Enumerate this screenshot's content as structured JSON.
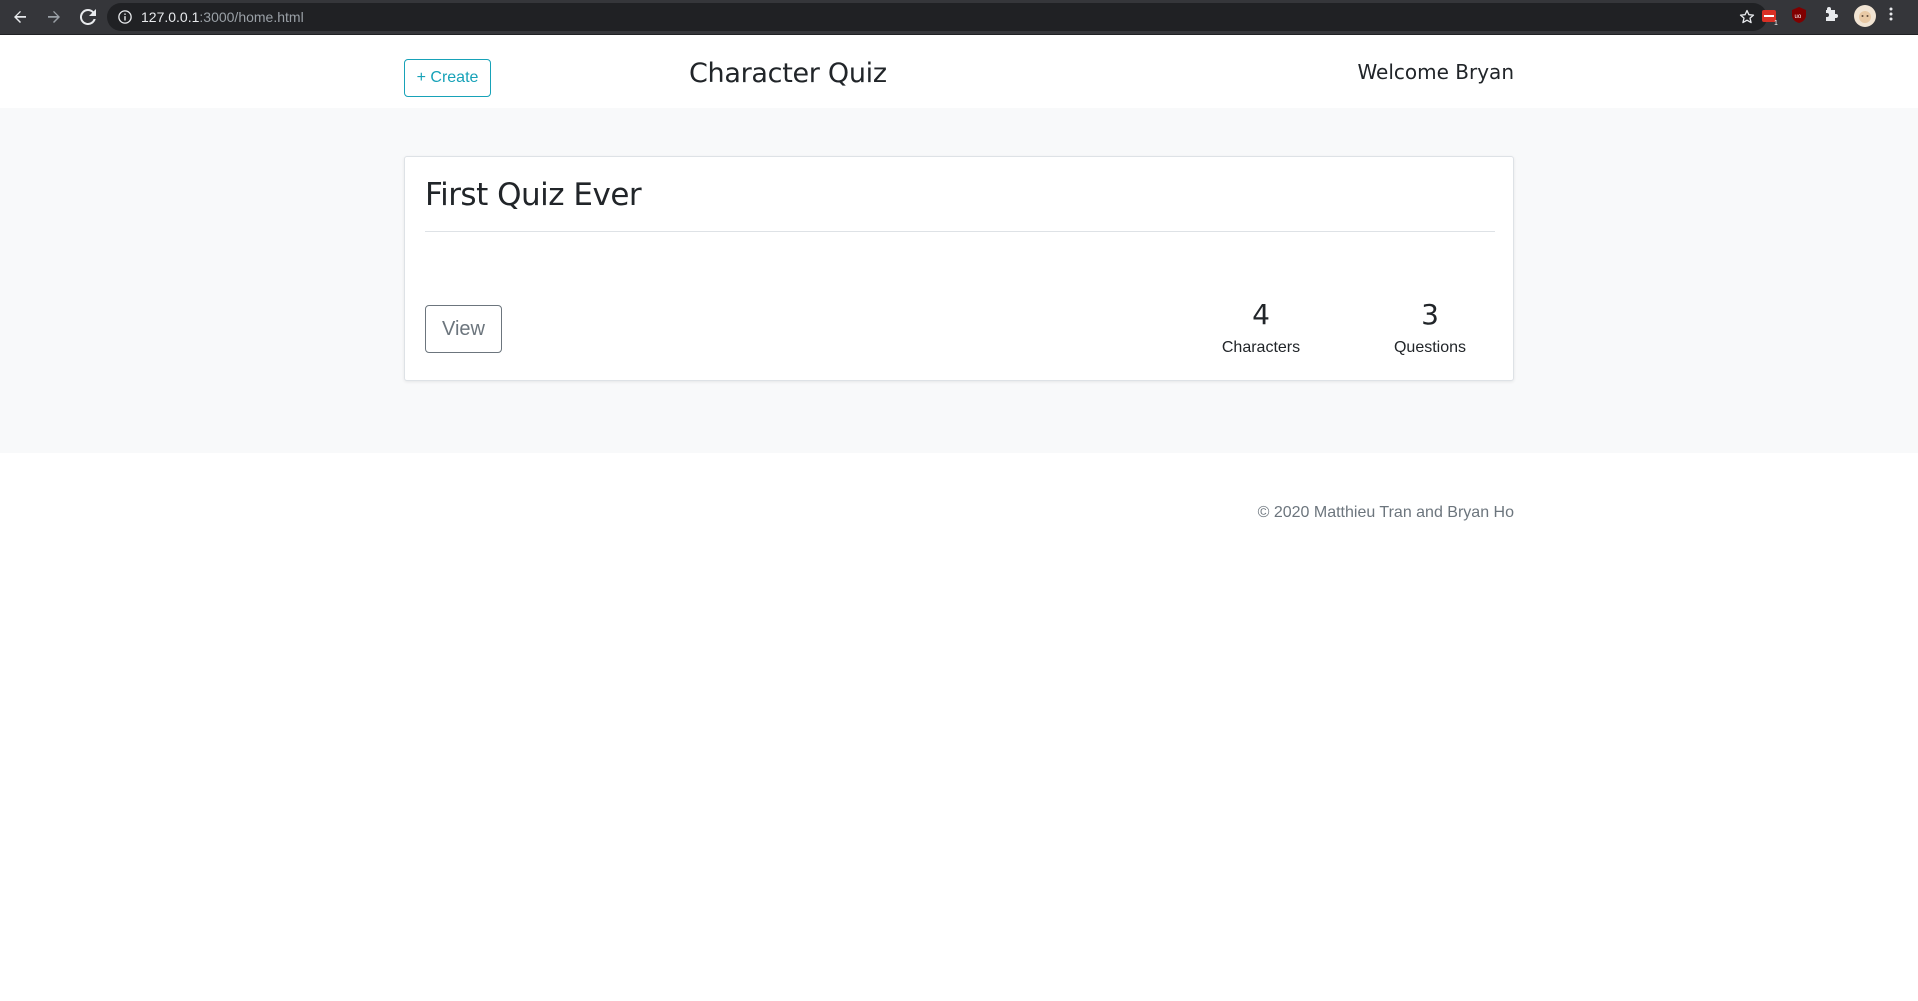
{
  "browser": {
    "url_host": "127.0.0.1",
    "url_path": ":3000/home.html",
    "icons": [
      "back-arrow-icon",
      "forward-arrow-icon",
      "reload-icon",
      "info-icon",
      "star-icon",
      "extension-icon",
      "puzzle-icon",
      "avatar",
      "kebab-menu-icon"
    ]
  },
  "navbar": {
    "create_label": "+ Create",
    "title": "Character Quiz",
    "welcome": "Welcome Bryan"
  },
  "quizzes": [
    {
      "title": "First Quiz Ever",
      "view_label": "View",
      "characters_count": "4",
      "characters_label": "Characters",
      "questions_count": "3",
      "questions_label": "Questions"
    }
  ],
  "footer": {
    "copyright": "© 2020 Matthieu Tran and Bryan Ho"
  },
  "colors": {
    "accent": "#17a2b8",
    "secondary": "#6c757d",
    "band_background": "#f8f9fa",
    "chrome_background": "#35363a"
  }
}
